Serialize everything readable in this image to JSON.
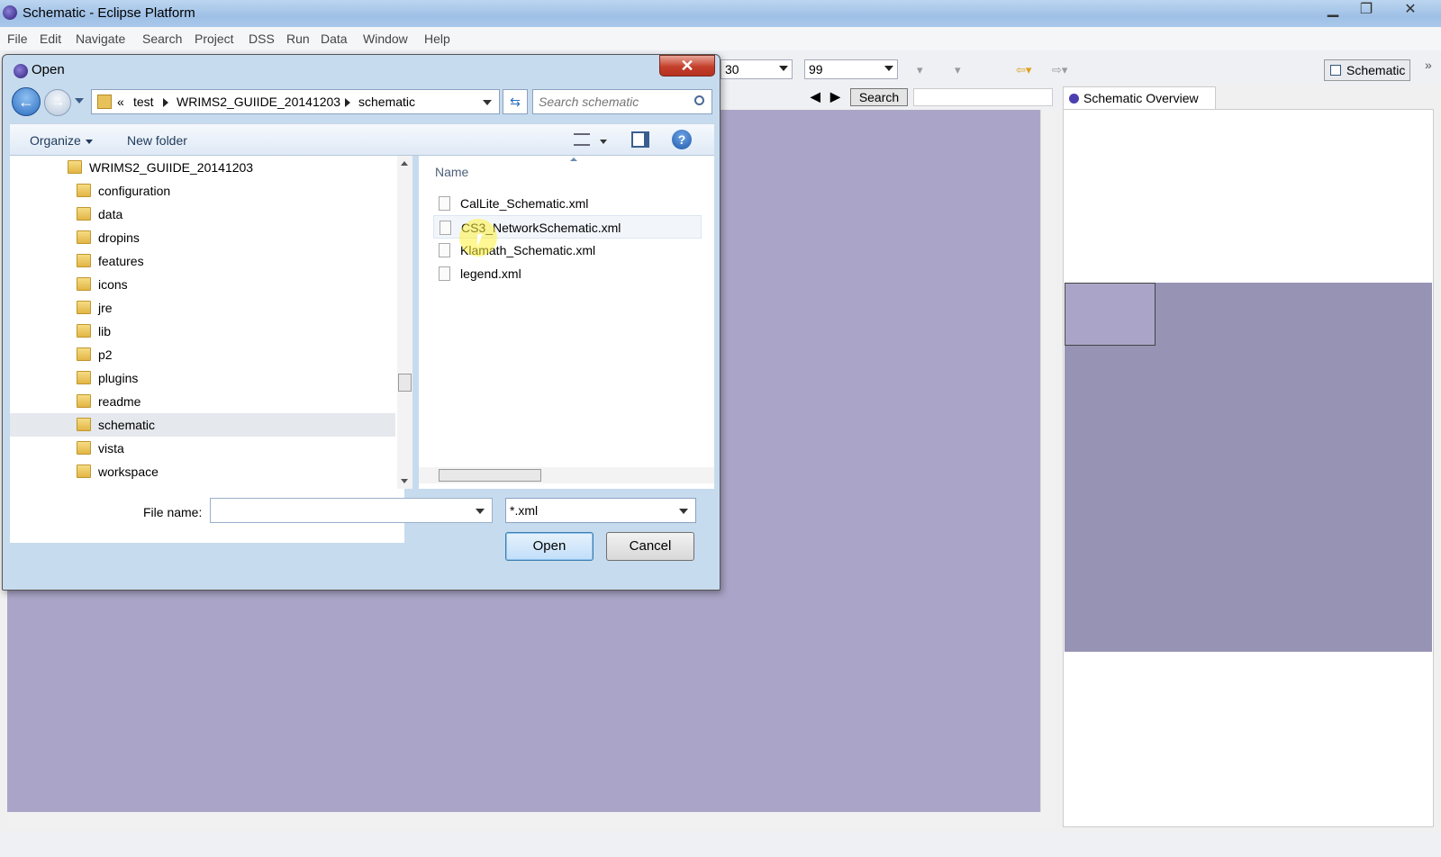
{
  "window": {
    "title": "Schematic - Eclipse Platform",
    "minimize": "▁",
    "restore": "❐",
    "close": "✕"
  },
  "menu": [
    "File",
    "Edit",
    "Navigate",
    "Search",
    "Project",
    "DSS",
    "Run",
    "Data",
    "Window",
    "Help"
  ],
  "toolbar": {
    "combo1_value": "30",
    "combo2_value": "99",
    "search_button": "Search",
    "perspective": "Schematic"
  },
  "overview": {
    "tab_label": "Schematic Overview"
  },
  "dialog": {
    "title": "Open",
    "close": "✕",
    "breadcrumb": {
      "overflow": "«",
      "parts": [
        "test",
        "WRIMS2_GUIIDE_20141203",
        "schematic"
      ]
    },
    "search_placeholder": "Search schematic",
    "organize": "Organize",
    "new_folder": "New folder",
    "help": "?",
    "tree": {
      "root": "WRIMS2_GUIIDE_20141203",
      "items": [
        "configuration",
        "data",
        "dropins",
        "features",
        "icons",
        "jre",
        "lib",
        "p2",
        "plugins",
        "readme",
        "schematic",
        "vista",
        "workspace"
      ],
      "selected": "schematic"
    },
    "files": {
      "column": "Name",
      "items": [
        "CalLite_Schematic.xml",
        "CS3_NetworkSchematic.xml",
        "Klamath_Schematic.xml",
        "legend.xml"
      ],
      "hovered": "CS3_NetworkSchematic.xml"
    },
    "file_name_label": "File name:",
    "file_name_value": "",
    "file_type": "*.xml",
    "open_button": "Open",
    "cancel_button": "Cancel"
  },
  "colors": {
    "canvas": "#aaa5c8",
    "overview_fill": "#9793b4",
    "dialog_frame": "#c7dbee"
  }
}
